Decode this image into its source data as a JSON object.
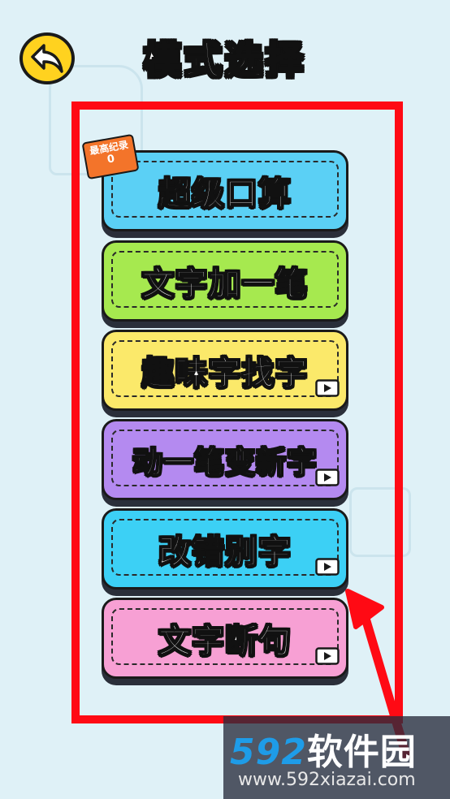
{
  "header": {
    "title": "模式选择",
    "back_icon": "back-arrow-icon"
  },
  "record": {
    "label": "最高纪录",
    "value": "0"
  },
  "modes": [
    {
      "label": "超级口算",
      "color": "#5bd0f5",
      "has_video": false
    },
    {
      "label": "文字加一笔",
      "color": "#a6e94f",
      "has_video": false
    },
    {
      "label": "趣味字找字",
      "color": "#fbe96a",
      "has_video": true
    },
    {
      "label": "动一笔变新字",
      "color": "#b48af0",
      "has_video": true
    },
    {
      "label": "改错别字",
      "color": "#3cd0f5",
      "has_video": true
    },
    {
      "label": "文字断句",
      "color": "#f7a0d4",
      "has_video": true
    }
  ],
  "watermark": {
    "digits": "592",
    "name": "软件园",
    "url": "www.592xiazai.com"
  },
  "annotation_color": "#ff0a14"
}
